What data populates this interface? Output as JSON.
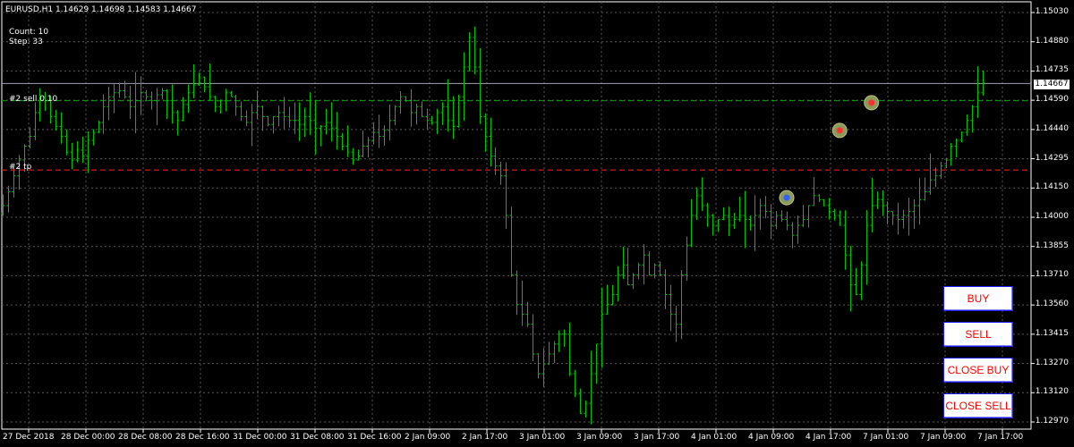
{
  "header": {
    "symbol_line": "EURUSD,H1  1.14629 1.14698 1.14583 1.14667",
    "count_line": "Count: 10",
    "step_line": "Step: 33"
  },
  "order_lines": {
    "sell_label": "#2 sell 0.10",
    "tp_label": "#2 tp",
    "sell_price": 1.1458,
    "tp_price": 1.1423,
    "current_price": 1.14667
  },
  "current_price_label": "1.14667",
  "price_axis": [
    "1.15030",
    "1.14880",
    "1.14735",
    "1.14590",
    "1.14440",
    "1.14295",
    "1.14150",
    "1.14000",
    "1.13855",
    "1.13710",
    "1.13560",
    "1.13415",
    "1.13270",
    "1.13120",
    "1.12970"
  ],
  "time_axis": [
    "27 Dec 2018",
    "28 Dec 00:00",
    "28 Dec 08:00",
    "28 Dec 16:00",
    "31 Dec 00:00",
    "31 Dec 08:00",
    "31 Dec 16:00",
    "2 Jan 09:00",
    "2 Jan 17:00",
    "3 Jan 01:00",
    "3 Jan 09:00",
    "3 Jan 17:00",
    "4 Jan 01:00",
    "4 Jan 09:00",
    "4 Jan 17:00",
    "7 Jan 01:00",
    "7 Jan 09:00",
    "7 Jan 17:00"
  ],
  "buttons": {
    "buy": "BUY",
    "sell": "SELL",
    "close_buy": "CLOSE BUY",
    "close_sell": "CLOSE SELL"
  },
  "colors": {
    "bars": "#00c000",
    "grid": "#5a5a5a",
    "sell_line": "#00a000",
    "tp_line": "#ff2020",
    "price_line": "#a0a0b0",
    "button_text": "#ff0000",
    "button_border": "#1c1cff"
  },
  "chart_data": {
    "type": "ohlc",
    "symbol": "EURUSD",
    "timeframe": "H1",
    "ylim": [
      1.1292,
      1.1508
    ],
    "markers": [
      {
        "kind": "buy-entry-icon",
        "bar": 148,
        "price": 1.1409
      },
      {
        "kind": "sell-entry-icon",
        "bar": 158,
        "price": 1.1443
      },
      {
        "kind": "sell-entry-icon",
        "bar": 164,
        "price": 1.1457
      }
    ],
    "closes": [
      1.1405,
      1.1412,
      1.142,
      1.1428,
      1.1435,
      1.144,
      1.1452,
      1.146,
      1.1458,
      1.145,
      1.1445,
      1.144,
      1.1432,
      1.1428,
      1.1433,
      1.143,
      1.1438,
      1.1442,
      1.1447,
      1.1455,
      1.146,
      1.1462,
      1.1463,
      1.146,
      1.1455,
      1.1458,
      1.1462,
      1.146,
      1.1458,
      1.1461,
      1.1463,
      1.1458,
      1.1452,
      1.1448,
      1.1456,
      1.1462,
      1.1466,
      1.147,
      1.1465,
      1.146,
      1.1455,
      1.1458,
      1.1462,
      1.146,
      1.1455,
      1.145,
      1.1447,
      1.1452,
      1.1455,
      1.145,
      1.1446,
      1.145,
      1.1452,
      1.145,
      1.1448,
      1.1448,
      1.1446,
      1.145,
      1.1448,
      1.1444,
      1.1445,
      1.1447,
      1.1444,
      1.144,
      1.1435,
      1.1432,
      1.1428,
      1.143,
      1.1435,
      1.1438,
      1.1442,
      1.144,
      1.1443,
      1.1448,
      1.1455,
      1.146,
      1.1458,
      1.1452,
      1.1455,
      1.145,
      1.1448,
      1.1447,
      1.1452,
      1.1455,
      1.1448,
      1.1445,
      1.146,
      1.1475,
      1.149,
      1.1475,
      1.145,
      1.144,
      1.143,
      1.1425,
      1.142,
      1.14,
      1.137,
      1.1355,
      1.135,
      1.1345,
      1.133,
      1.132,
      1.1325,
      1.133,
      1.1335,
      1.134,
      1.134,
      1.132,
      1.131,
      1.13,
      1.1305,
      1.132,
      1.1335,
      1.135,
      1.1355,
      1.136,
      1.137,
      1.1375,
      1.1365,
      1.137,
      1.1375,
      1.138,
      1.137,
      1.1375,
      1.137,
      1.136,
      1.135,
      1.1345,
      1.137,
      1.1385,
      1.14,
      1.141,
      1.1405,
      1.14,
      1.1395,
      1.1398,
      1.14,
      1.1395,
      1.1398,
      1.14,
      1.1398,
      1.1395,
      1.14,
      1.1405,
      1.1402,
      1.1395,
      1.14,
      1.1398,
      1.1395,
      1.139,
      1.1395,
      1.1398,
      1.1405,
      1.141,
      1.1408,
      1.1405,
      1.1402,
      1.14,
      1.1395,
      1.138,
      1.1365,
      1.136,
      1.1375,
      1.1395,
      1.1405,
      1.1408,
      1.1405,
      1.1402,
      1.14,
      1.1398,
      1.14,
      1.1402,
      1.1405,
      1.1408,
      1.1412,
      1.1418,
      1.142,
      1.1425,
      1.1428,
      1.1435,
      1.1438,
      1.1442,
      1.1448,
      1.1455,
      1.1462,
      1.1467
    ]
  }
}
